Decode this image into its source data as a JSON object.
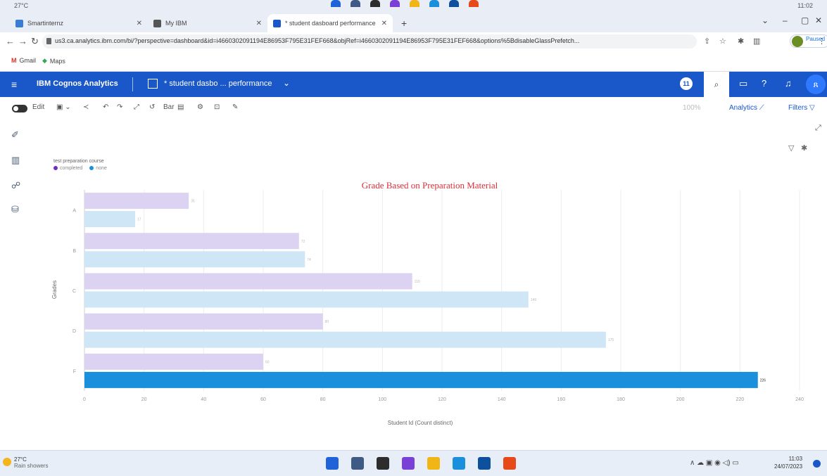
{
  "os_top": {
    "weather_temp": "27°C",
    "clock": "11:02"
  },
  "tabs": [
    {
      "label": "Smartinternz",
      "fav_color": "#3a7bd5"
    },
    {
      "label": "My IBM",
      "fav_color": "#555555"
    },
    {
      "label": "* student dasboard performance",
      "fav_color": "#1a57c8"
    }
  ],
  "addressbar": {
    "url": "us3.ca.analytics.ibm.com/bi/?perspective=dashboard&id=i4660302091194E86953F795E31FEF668&objRef=i4660302091194E86953F795E31FEF668&options%5BdisableGlassPrefetch...",
    "profile_status": "Paused"
  },
  "bookmarks": [
    {
      "label": "Gmail",
      "color": "#d93025"
    },
    {
      "label": "Maps",
      "color": "#34a853"
    }
  ],
  "header": {
    "brand": "IBM Cognos Analytics",
    "dashboard_name": "* student dasbo ... performance",
    "notifications": "11",
    "bg_color": "#1a57c8"
  },
  "toolbar": {
    "edit_label": "Edit",
    "viz_type": "Bar",
    "zoom": "100%",
    "analytics_label": "Analytics",
    "filters_label": "Filters"
  },
  "chart_data": {
    "type": "bar",
    "orientation": "horizontal",
    "title": "Grade Based on Preparation Material",
    "xlabel": "Student Id (Count distinct)",
    "ylabel": "Grades",
    "legend_title": "test preparation course",
    "legend_placement": "top-left",
    "categories": [
      "A",
      "B",
      "C",
      "D",
      "F"
    ],
    "series": [
      {
        "name": "completed",
        "color": "#dcd2f1",
        "values": [
          35,
          72,
          110,
          80,
          60
        ]
      },
      {
        "name": "none",
        "color": "#cfe6f7",
        "highlight_color": "#1a8fdc",
        "values": [
          17,
          74,
          149,
          175,
          226
        ]
      }
    ],
    "highlight": {
      "series": "none",
      "category": "F"
    },
    "xlim": [
      0,
      240
    ],
    "xticks": [
      0,
      20,
      40,
      60,
      80,
      100,
      120,
      140,
      160,
      180,
      200,
      220,
      240
    ],
    "grid": true
  },
  "taskbar": {
    "weather_temp": "27°C",
    "weather_desc": "Rain showers",
    "time": "11:03",
    "date": "24/07/2023",
    "apps": [
      "#1e64d8",
      "#3f5a85",
      "#2d2d2d",
      "#7a3fd6",
      "#f1b515",
      "#1a8fdc",
      "#0e4f9e",
      "#e64a19"
    ]
  }
}
